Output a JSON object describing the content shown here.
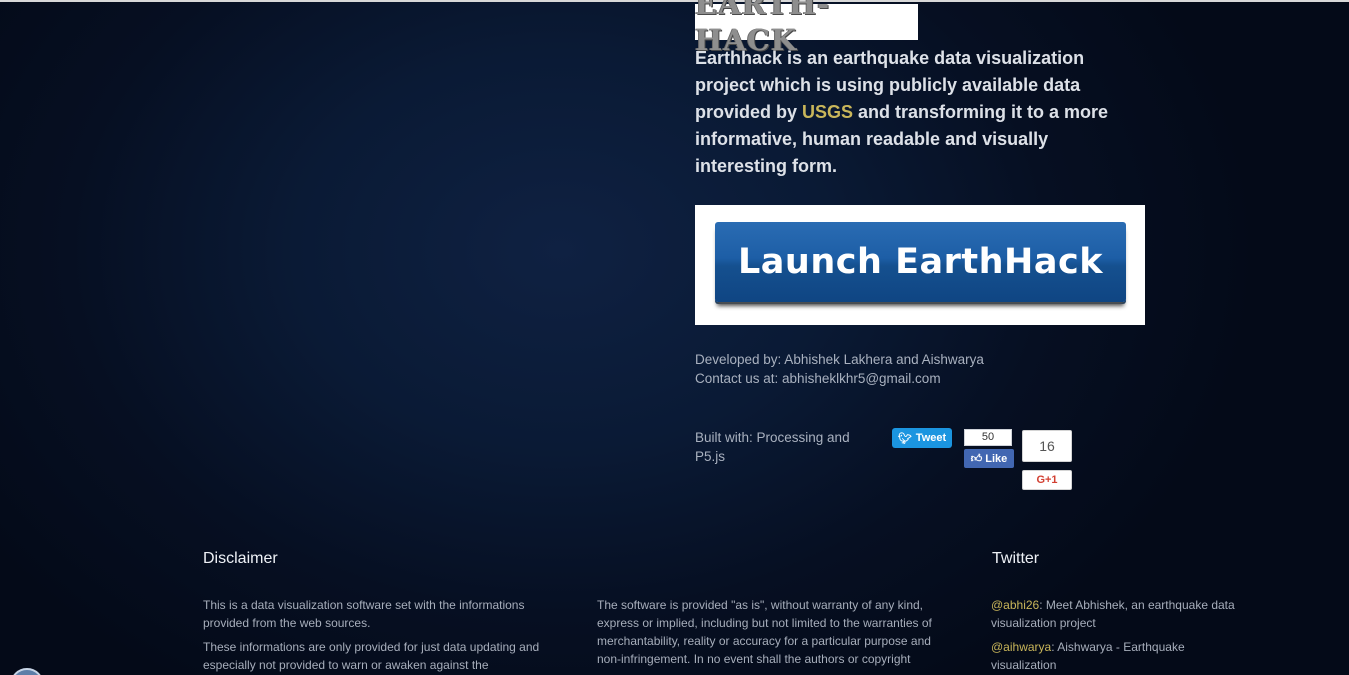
{
  "logo": {
    "text": "EARTH-HACK"
  },
  "intro": {
    "before": "Earthhack is an earthquake data visualization project which is using publicly available data provided by ",
    "link": "USGS",
    "after": " and transforming it to a more informative, human readable and visually interesting form."
  },
  "launch": {
    "label": "Launch EarthHack"
  },
  "credits": {
    "developed": "Developed by: Abhishek Lakhera and Aishwarya",
    "contact": "Contact us at: abhisheklkhr5@gmail.com",
    "built": "Built with: Processing and P5.js"
  },
  "social": {
    "tweet_label": "Tweet",
    "fb_count": "50",
    "fb_label": "Like",
    "gplus_count": "16",
    "gplus_label": "G+1"
  },
  "footer": {
    "disclaimer_heading": "Disclaimer",
    "disclaimer_p1": "This is a data visualization software set with the informations provided from the web sources.",
    "disclaimer_p2": "These informations are only provided for just data updating and especially not provided to warn or awaken against the",
    "warranty_p1": "The software is provided \"as is\", without warranty of any kind, express or implied, including but not limited to the warranties of merchantability, reality or accuracy for a particular purpose and non-infringement. In no event shall the authors or copyright",
    "twitter_heading": "Twitter",
    "tweets": [
      {
        "handle": "@abhi26",
        "text": ": Meet Abhishek, an earthquake data visualization project"
      },
      {
        "handle": "@aihwarya",
        "text": ": Aishwarya - Earthquake visualization"
      }
    ]
  }
}
